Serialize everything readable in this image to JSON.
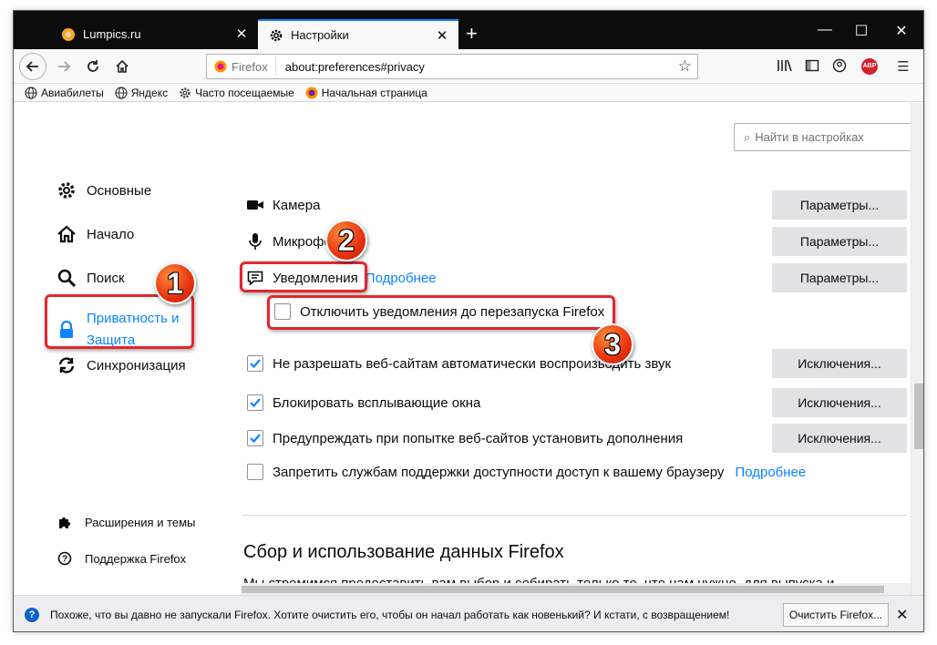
{
  "tabs": [
    {
      "title": "Lumpics.ru",
      "icon": "lumpics-favicon"
    },
    {
      "title": "Настройки",
      "icon": "gear-icon"
    }
  ],
  "toolbar": {
    "identity_label": "Firefox",
    "url": "about:preferences#privacy"
  },
  "bookmarks": [
    {
      "label": "Авиабилеты",
      "icon": "globe-icon"
    },
    {
      "label": "Яндекс",
      "icon": "globe-icon"
    },
    {
      "label": "Часто посещаемые",
      "icon": "gear-icon"
    },
    {
      "label": "Начальная страница",
      "icon": "firefox-icon"
    }
  ],
  "search": {
    "placeholder": "Найти в настройках"
  },
  "sidebar": {
    "items": [
      {
        "label": "Основные",
        "icon": "gear-icon"
      },
      {
        "label": "Начало",
        "icon": "home-icon"
      },
      {
        "label": "Поиск",
        "icon": "search-icon"
      },
      {
        "label_line1": "Приватность и",
        "label_line2": "Защита",
        "icon": "lock-icon",
        "selected": true
      },
      {
        "label": "Синхронизация",
        "icon": "sync-icon"
      }
    ],
    "footer": [
      {
        "label": "Расширения и темы",
        "icon": "puzzle-icon"
      },
      {
        "label": "Поддержка Firefox",
        "icon": "help-icon"
      }
    ]
  },
  "permissions": {
    "camera": {
      "label": "Камера",
      "button": "Параметры..."
    },
    "microphone": {
      "label": "Микрофон",
      "button": "Параметры..."
    },
    "notifications": {
      "label": "Уведомления",
      "link": "Подробнее",
      "button": "Параметры..."
    },
    "pause_notifications": {
      "label": "Отключить уведомления до перезапуска Firefox",
      "checked": false
    },
    "autoplay": {
      "label": "Не разрешать веб-сайтам автоматически воспроизводить звук",
      "checked": true,
      "button": "Исключения..."
    },
    "popups": {
      "label": "Блокировать всплывающие окна",
      "checked": true,
      "button": "Исключения..."
    },
    "addons": {
      "label": "Предупреждать при попытке веб-сайтов установить дополнения",
      "checked": true,
      "button": "Исключения..."
    },
    "accessibility": {
      "label": "Запретить службам поддержки доступности доступ к вашему браузеру",
      "checked": false,
      "link": "Подробнее"
    }
  },
  "data_collection": {
    "title": "Сбор и использование данных Firefox",
    "text": "Мы стремимся предоставить вам выбор и собирать только то, что нам нужно, для выпуска и"
  },
  "notification_bar": {
    "text": "Похоже, что вы давно не запускали Firefox. Хотите очистить его, чтобы он начал работать как новенький? И кстати, с возвращением!",
    "button": "Очистить Firefox..."
  },
  "annotations": {
    "badge1": "1",
    "badge2": "2",
    "badge3": "3"
  },
  "colors": {
    "accent": "#0a84ff",
    "highlight": "#e4262c",
    "tabstrip": "#0c0c0d"
  }
}
